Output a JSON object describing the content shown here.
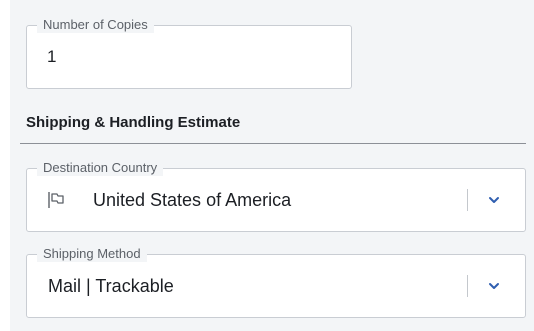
{
  "copies": {
    "label": "Number of Copies",
    "value": "1"
  },
  "shipping": {
    "section_title": "Shipping & Handling Estimate",
    "destination": {
      "label": "Destination Country",
      "value": "United States of America",
      "icon": "flag-icon"
    },
    "method": {
      "label": "Shipping Method",
      "value": "Mail | Trackable"
    }
  },
  "colors": {
    "accent": "#2f5fb0",
    "panel_background": "#f3f5f7",
    "field_border": "#c9cdd3",
    "text": "#1c1f24"
  }
}
